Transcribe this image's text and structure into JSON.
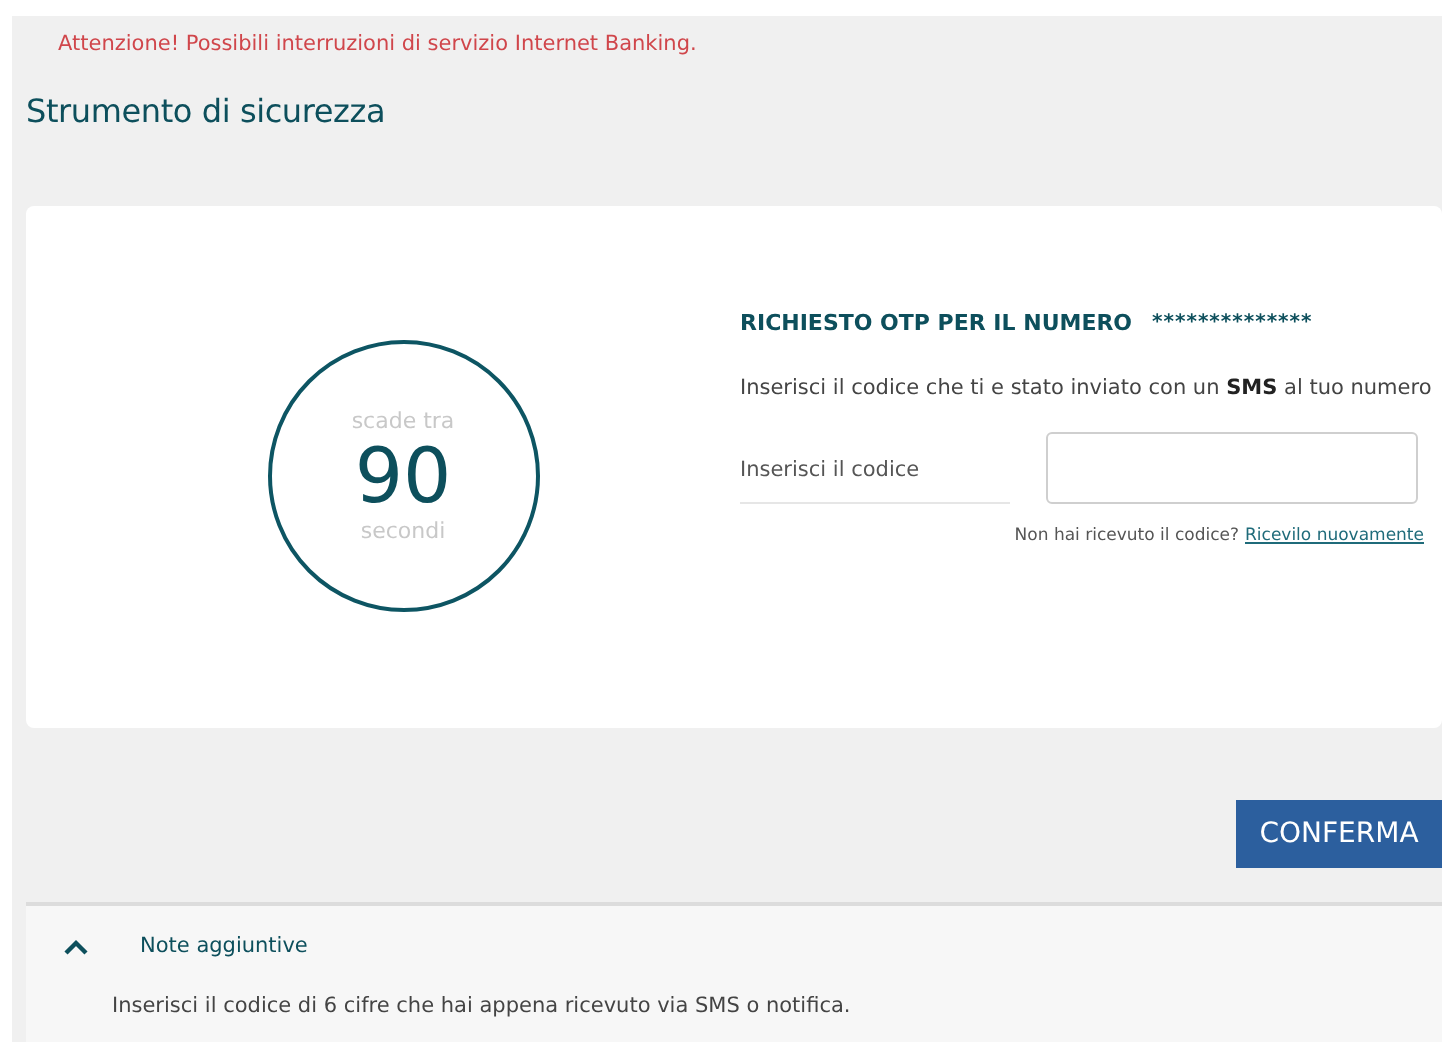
{
  "alert": "Attenzione! Possibili interruzioni di servizio Internet Banking.",
  "page_title": "Strumento di sicurezza",
  "timer": {
    "caption_top": "scade tra",
    "value": "90",
    "caption_bottom": "secondi"
  },
  "otp": {
    "heading": "RICHIESTO OTP PER IL NUMERO",
    "masked_number": "**************",
    "instruction": "Inserisci il codice che ti e stato inviato con un **SMS** al tuo numero",
    "code_label": "Inserisci il codice",
    "resend_question": "Non hai ricevuto il codice?",
    "resend_link": "Ricevilo nuovamente"
  },
  "confirm_button": "CONFERMA",
  "notes": {
    "title": "Note aggiuntive",
    "expanded": true,
    "body": "Inserisci il codice di 6 cifre che hai appena ricevuto via SMS o notifica."
  }
}
